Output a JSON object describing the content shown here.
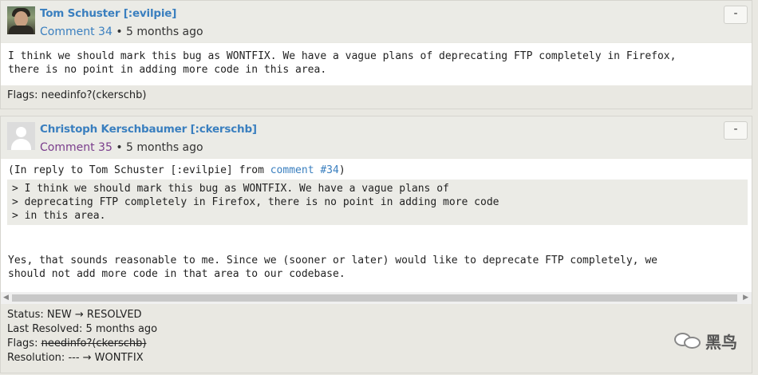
{
  "comments": [
    {
      "author": "Tom Schuster [:evilpie]",
      "comment_link": "Comment 34",
      "time": "• 5 months ago",
      "collapse_label": "-",
      "body_lines": [
        "I think we should mark this bug as WONTFIX. We have a vague plans of deprecating FTP completely in Firefox,",
        "there is no point in adding more code in this area."
      ],
      "flags": "Flags: needinfo?(ckerschb)"
    },
    {
      "author": "Christoph Kerschbaumer [:ckerschb]",
      "comment_link": "Comment 35",
      "time": "• 5 months ago",
      "collapse_label": "-",
      "reply_prefix": "(In reply to Tom Schuster [:evilpie] from ",
      "reply_link": "comment #34",
      "reply_suffix": ")",
      "quote_lines": [
        "> I think we should mark this bug as WONTFIX. We have a vague plans of",
        "> deprecating FTP completely in Firefox, there is no point in adding more code",
        "> in this area."
      ],
      "reply_lines": [
        "Yes, that sounds reasonable to me. Since we (sooner or later) would like to deprecate FTP completely, we",
        "should not add more code in that area to our codebase."
      ],
      "changes": {
        "status": "Status: NEW → RESOLVED",
        "last_resolved": "Last Resolved: 5 months ago",
        "flags_label": "Flags: ",
        "flags_value": "needinfo?(ckerschb)",
        "resolution": "Resolution: --- → WONTFIX"
      }
    }
  ],
  "watermark": {
    "text": "黑鸟",
    "icon": "wechat-icon"
  },
  "icons": {
    "collapse": "minus-icon",
    "scroll_left": "arrow-left-icon",
    "scroll_right": "arrow-right-icon"
  }
}
